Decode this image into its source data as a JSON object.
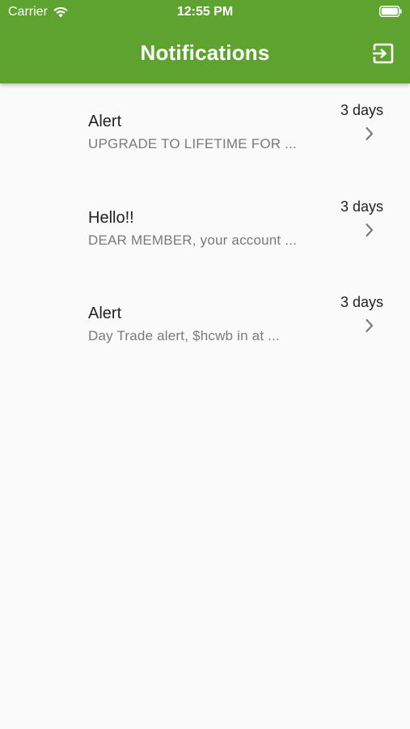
{
  "status_bar": {
    "carrier": "Carrier",
    "time": "12:55 PM"
  },
  "header": {
    "title": "Notifications",
    "background_color": "#5ea32f",
    "logout_icon": "logout-icon"
  },
  "notifications": [
    {
      "title": "Alert",
      "preview": "UPGRADE TO LIFETIME FOR ...",
      "time": "3 days"
    },
    {
      "title": "Hello!!",
      "preview": "DEAR MEMBER, your account ...",
      "time": "3 days"
    },
    {
      "title": "Alert",
      "preview": "Day Trade alert, $hcwb in at ...",
      "time": "3 days"
    }
  ]
}
